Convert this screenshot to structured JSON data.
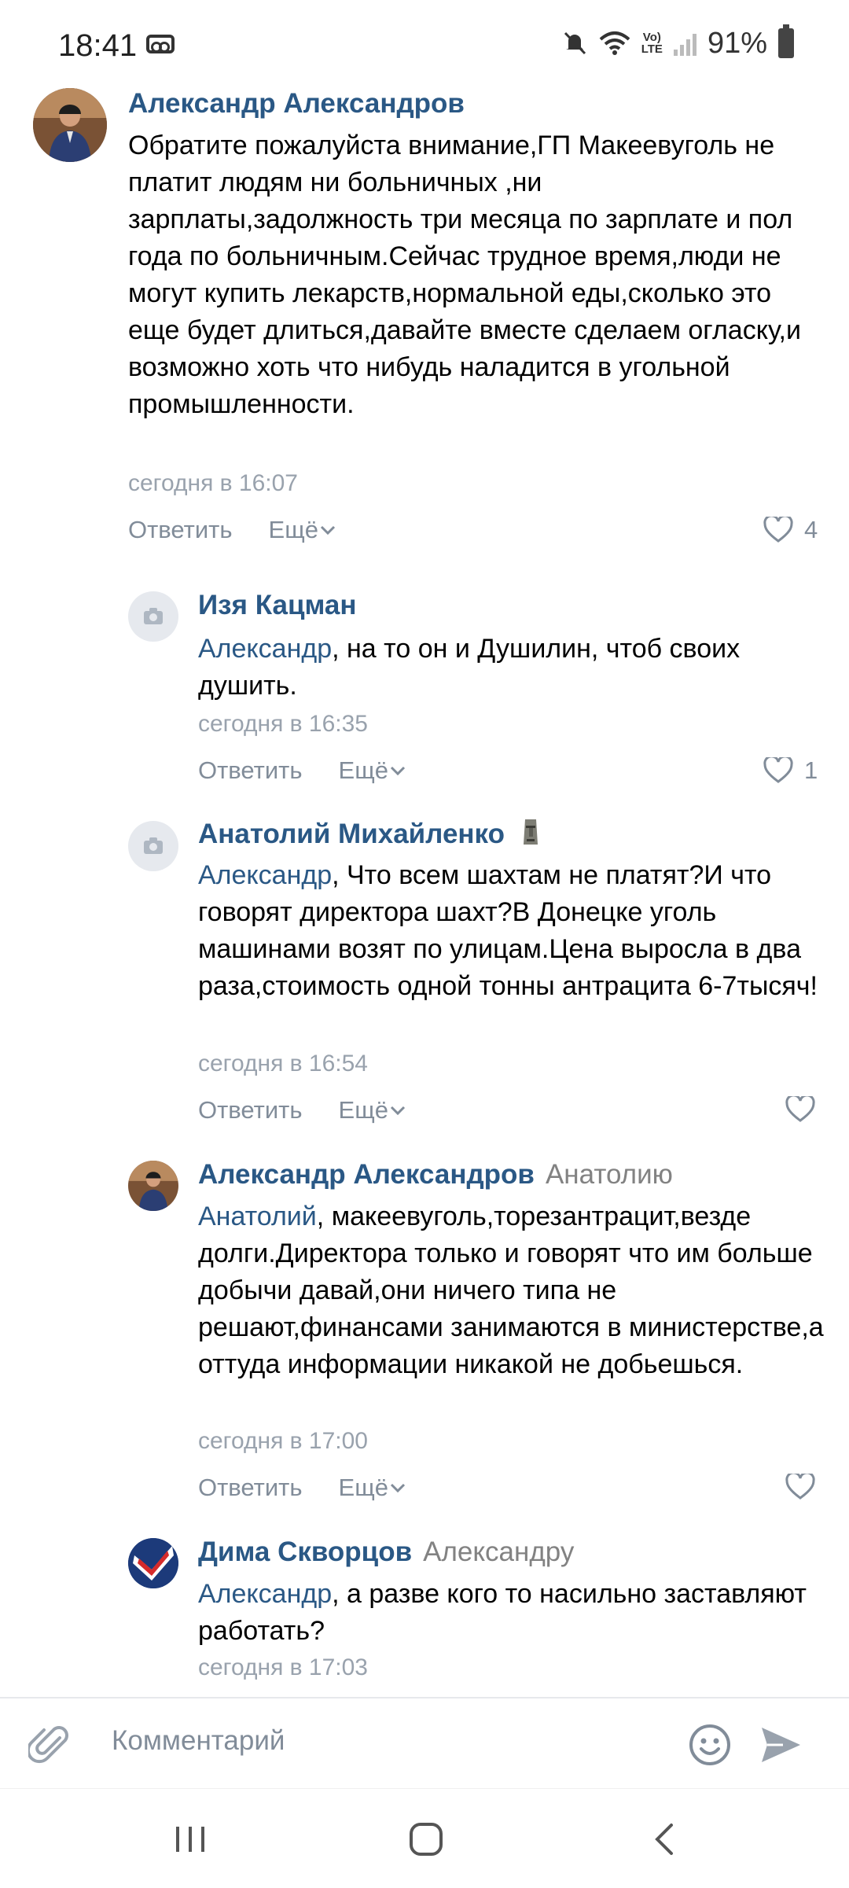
{
  "status_bar": {
    "time": "18:41",
    "battery": "91%"
  },
  "comments": [
    {
      "author": "Александр Александров",
      "text": "Обратите пожалуйста внимание,ГП Макеевуголь не платит людям ни больничных ,ни зарплаты,задолжность три месяца по зарплате и пол года по больничным.Сейчас трудное время,люди не могут купить лекарств,нормальной еды,сколько это еще будет длиться,давайте вместе сделаем огласку,и возможно хоть что нибудь наладится в угольной промышленности.",
      "time": "сегодня в 16:07",
      "reply_label": "Ответить",
      "more_label": "Ещё",
      "likes": "4"
    },
    {
      "author": "Изя Кацман",
      "mention": "Александр",
      "text": ", на то он и Душилин, чтоб своих душить.",
      "time": "сегодня в 16:35",
      "reply_label": "Ответить",
      "more_label": "Ещё",
      "likes": "1"
    },
    {
      "author": "Анатолий Михайленко",
      "mention": "Александр",
      "text": ", Что всем шахтам не платят?И что говорят директора шахт?В Донецке уголь машинами возят по улицам.Цена выросла в два раза,стоимость одной тонны антрацита 6-7тысяч!",
      "time": "сегодня в 16:54",
      "reply_label": "Ответить",
      "more_label": "Ещё",
      "likes": ""
    },
    {
      "author": "Александр Александров",
      "reply_to": "Анатолию",
      "mention": "Анатолий",
      "text": ", макеевуголь,торезантрацит,везде долги.Директора только и говорят что им больше добычи давай,они ничего типа не решают,финансами занимаются в министерстве,а оттуда информации никакой не добьешься.",
      "time": "сегодня в 17:00",
      "reply_label": "Ответить",
      "more_label": "Ещё",
      "likes": ""
    },
    {
      "author": "Дима Скворцов",
      "reply_to": "Александру",
      "mention": "Александр",
      "text": ", а разве кого то насильно заставляют работать?",
      "time": "сегодня в 17:03"
    }
  ],
  "composer": {
    "placeholder": "Комментарий"
  },
  "icons": {
    "attach": "paperclip-icon",
    "emoji": "smile-icon",
    "send": "send-icon",
    "nav_recents": "recents-icon",
    "nav_home": "home-icon",
    "nav_back": "back-icon"
  },
  "colors": {
    "link": "#2a5885",
    "meta": "#818c99",
    "time": "#99a2ad"
  }
}
